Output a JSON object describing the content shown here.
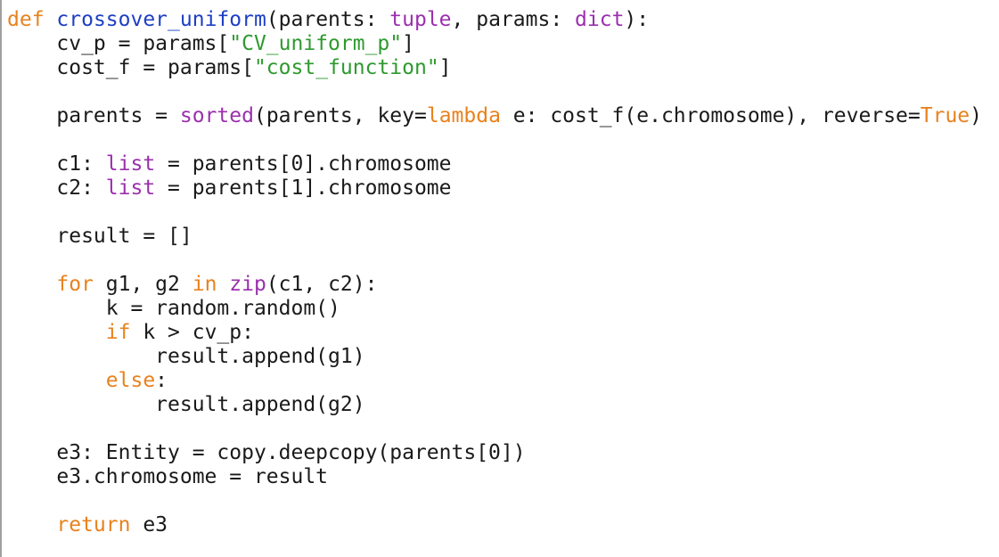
{
  "colors": {
    "background": "#ffffff",
    "default_text": "#1a1a1a",
    "keyword_orange": "#e8821e",
    "builtin_purple": "#9b2fae",
    "function_name_blue": "#1d3fc4",
    "string_green": "#2e9a2e"
  },
  "lines": [
    [
      [
        "k",
        "def"
      ],
      [
        "t",
        " "
      ],
      [
        "f",
        "crossover_uniform"
      ],
      [
        "t",
        "(parents: "
      ],
      [
        "p",
        "tuple"
      ],
      [
        "t",
        ", params: "
      ],
      [
        "p",
        "dict"
      ],
      [
        "t",
        "):"
      ]
    ],
    [
      [
        "t",
        "    cv_p = params["
      ],
      [
        "s",
        "\"CV_uniform_p\""
      ],
      [
        "t",
        "]"
      ]
    ],
    [
      [
        "t",
        "    cost_f = params["
      ],
      [
        "s",
        "\"cost_function\""
      ],
      [
        "t",
        "]"
      ]
    ],
    [],
    [
      [
        "t",
        "    parents = "
      ],
      [
        "p",
        "sorted"
      ],
      [
        "t",
        "(parents, key="
      ],
      [
        "k",
        "lambda"
      ],
      [
        "t",
        " e: cost_f(e.chromosome), reverse="
      ],
      [
        "k",
        "True"
      ],
      [
        "t",
        ")"
      ]
    ],
    [],
    [
      [
        "t",
        "    c1: "
      ],
      [
        "p",
        "list"
      ],
      [
        "t",
        " = parents[0].chromosome"
      ]
    ],
    [
      [
        "t",
        "    c2: "
      ],
      [
        "p",
        "list"
      ],
      [
        "t",
        " = parents[1].chromosome"
      ]
    ],
    [],
    [
      [
        "t",
        "    result = []"
      ]
    ],
    [],
    [
      [
        "t",
        "    "
      ],
      [
        "k",
        "for"
      ],
      [
        "t",
        " g1, g2 "
      ],
      [
        "k",
        "in"
      ],
      [
        "t",
        " "
      ],
      [
        "p",
        "zip"
      ],
      [
        "t",
        "(c1, c2):"
      ]
    ],
    [
      [
        "t",
        "        k = random.random()"
      ]
    ],
    [
      [
        "t",
        "        "
      ],
      [
        "k",
        "if"
      ],
      [
        "t",
        " k > cv_p:"
      ]
    ],
    [
      [
        "t",
        "            result.append(g1)"
      ]
    ],
    [
      [
        "t",
        "        "
      ],
      [
        "k",
        "else"
      ],
      [
        "t",
        ":"
      ]
    ],
    [
      [
        "t",
        "            result.append(g2)"
      ]
    ],
    [],
    [
      [
        "t",
        "    e3: Entity = copy.deepcopy(parents[0])"
      ]
    ],
    [
      [
        "t",
        "    e3.chromosome = result"
      ]
    ],
    [],
    [
      [
        "t",
        "    "
      ],
      [
        "k",
        "return"
      ],
      [
        "t",
        " e3"
      ]
    ]
  ]
}
